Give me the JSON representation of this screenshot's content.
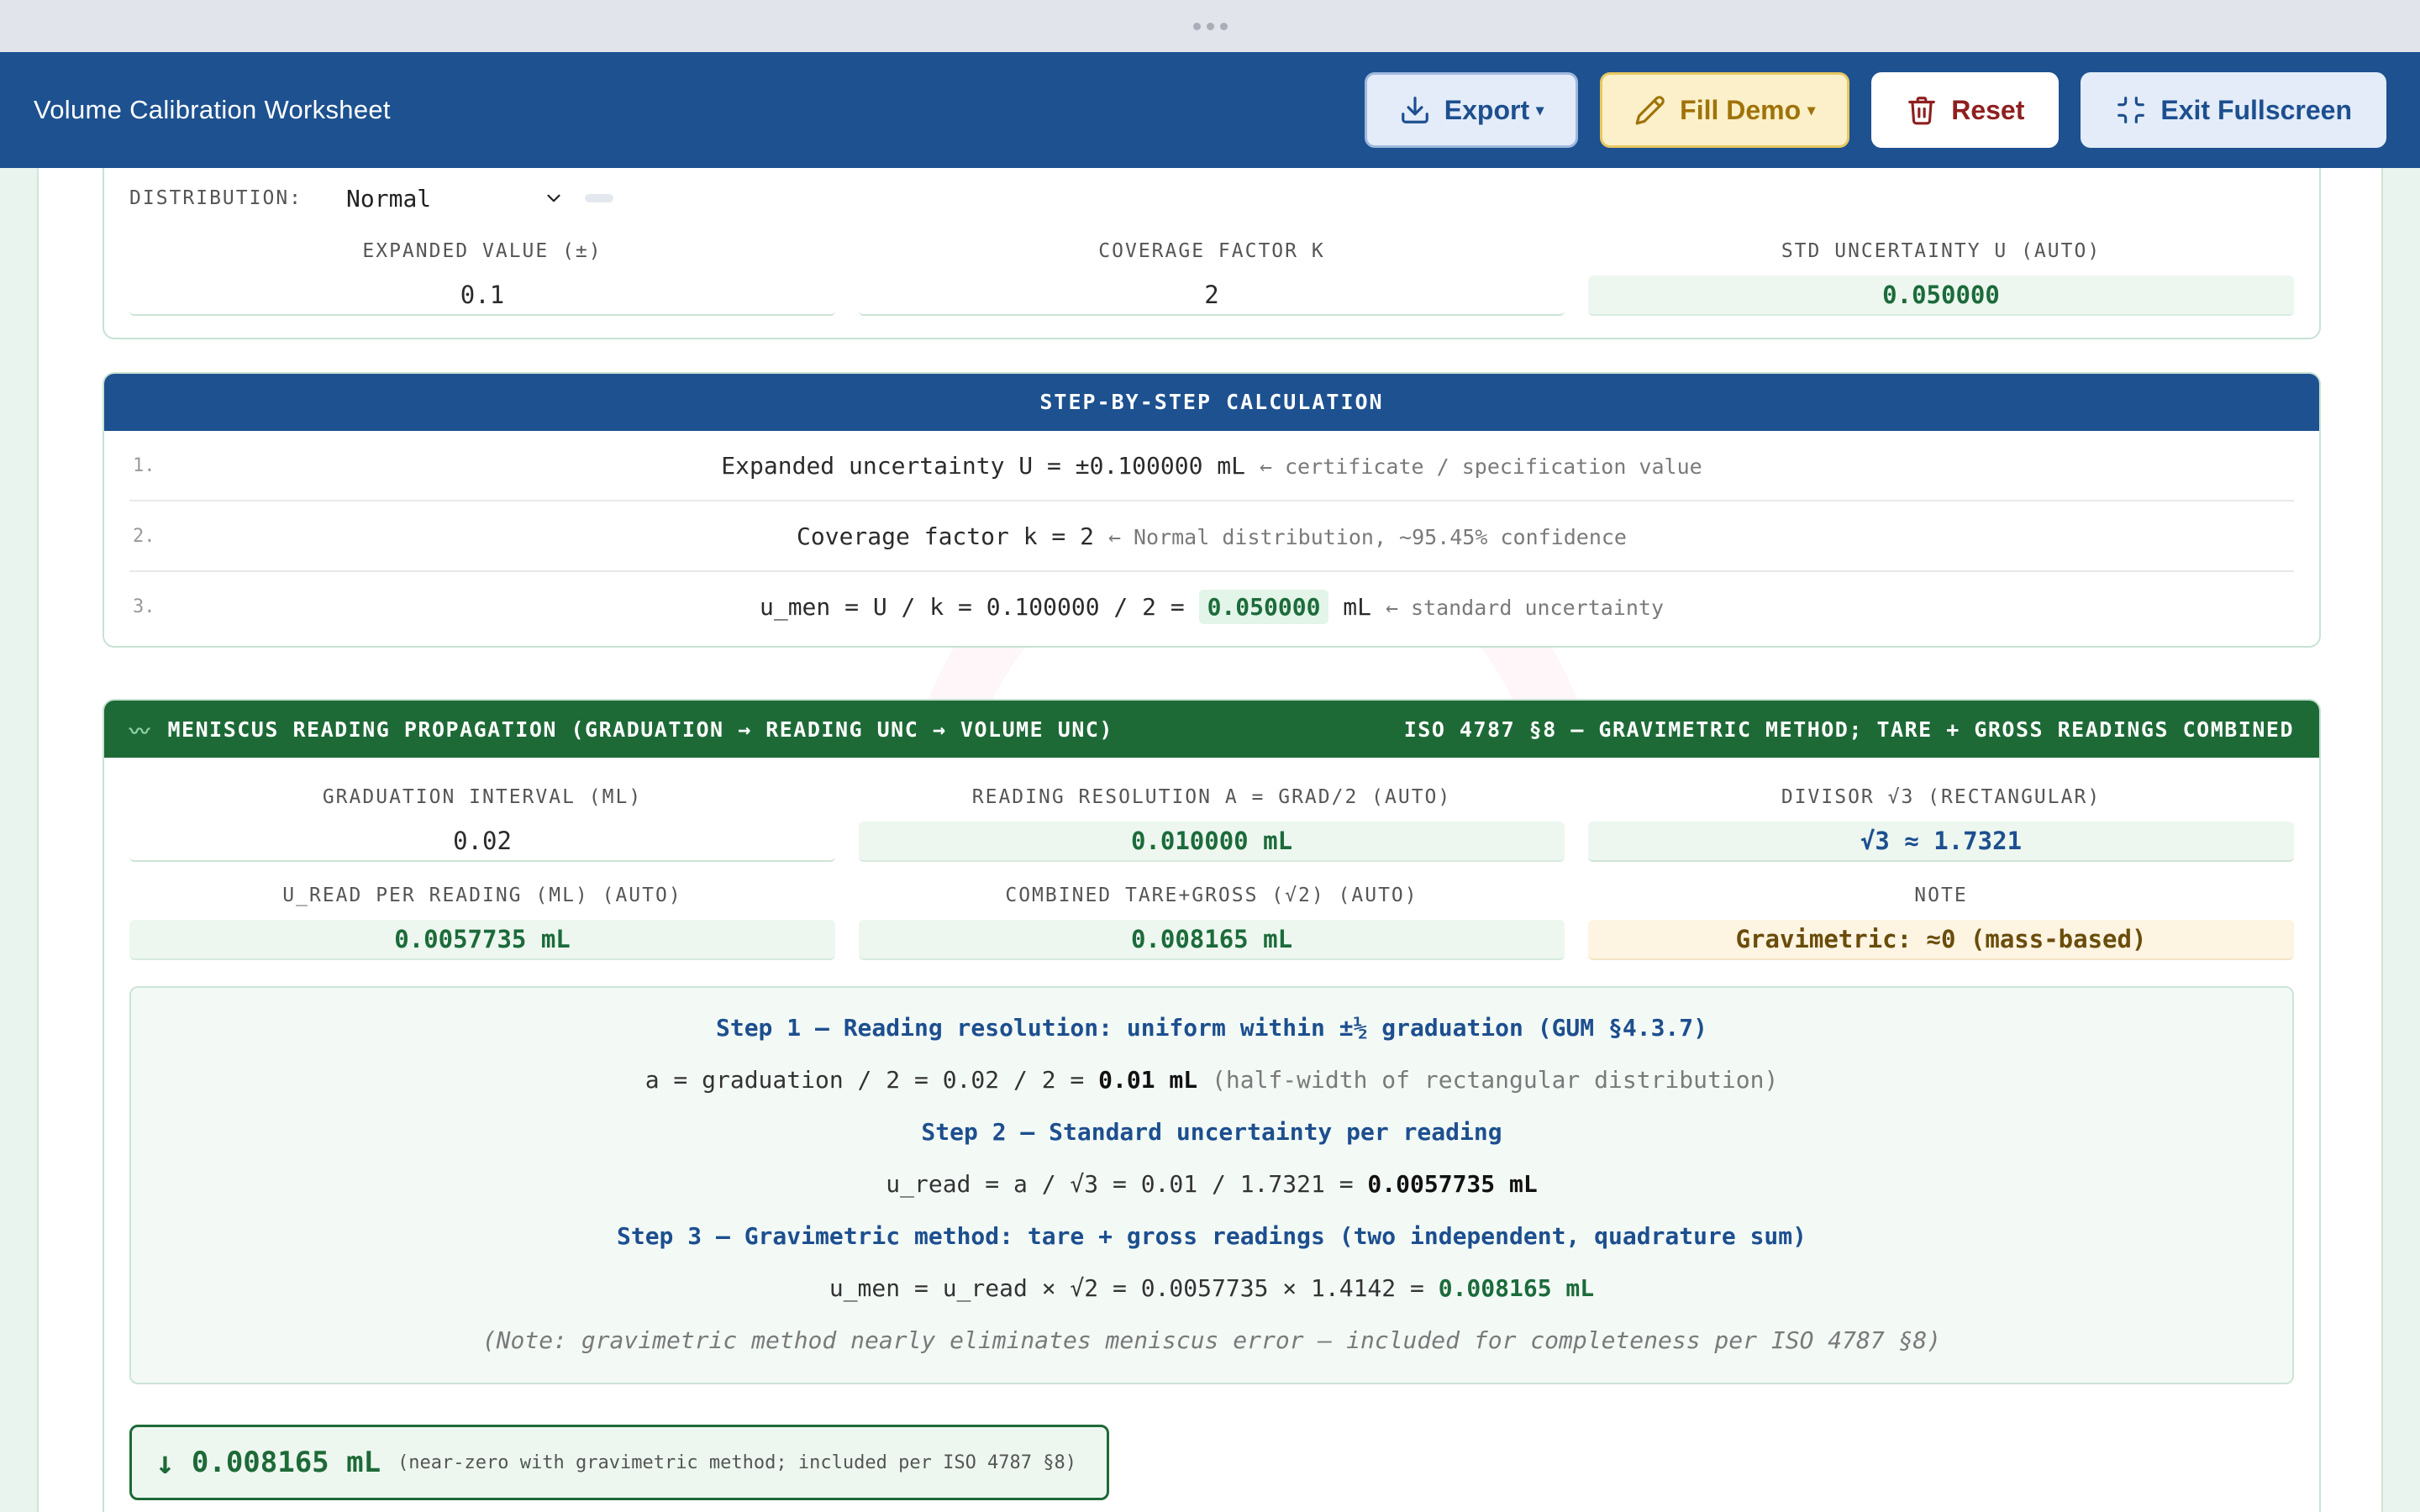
{
  "app": {
    "title": "Volume Calibration Worksheet",
    "buttons": {
      "export": "Export",
      "fill_demo": "Fill Demo",
      "reset": "Reset",
      "exit_fullscreen": "Exit Fullscreen"
    }
  },
  "certificate": {
    "distribution_label": "DISTRIBUTION:",
    "distribution_value": "Normal",
    "expanded_label": "EXPANDED VALUE (±)",
    "expanded_value": "0.1",
    "coverage_label": "COVERAGE FACTOR K",
    "coverage_value": "2",
    "std_label": "STD UNCERTAINTY U (AUTO)",
    "std_value": "0.050000"
  },
  "calculation": {
    "title": "STEP-BY-STEP CALCULATION",
    "rows": [
      {
        "num": "1.",
        "text": "Expanded uncertainty U = ±0.100000 mL ",
        "note": "← certificate / specification value"
      },
      {
        "num": "2.",
        "text": "Coverage factor k = 2 ",
        "note": "← Normal distribution, ~95.45% confidence"
      },
      {
        "num": "3.",
        "pre": "u_men = U / k = 0.100000 / 2 = ",
        "highlight": "0.050000",
        "post": " mL ",
        "note": "← standard uncertainty"
      }
    ]
  },
  "meniscus": {
    "icon": "〰",
    "title": "MENISCUS READING PROPAGATION (GRADUATION → READING UNC → VOLUME UNC)",
    "reference": "ISO 4787 §8 — GRAVIMETRIC METHOD; TARE + GROSS READINGS COMBINED",
    "fields": {
      "graduation_label": "GRADUATION INTERVAL (ML)",
      "graduation_value": "0.02",
      "resolution_label": "READING RESOLUTION A = GRAD/2 (AUTO)",
      "resolution_value": "0.010000 mL",
      "divisor_label": "DIVISOR √3 (RECTANGULAR)",
      "divisor_value": "√3 ≈ 1.7321",
      "uread_label": "U_READ PER READING (ML) (AUTO)",
      "uread_value": "0.0057735 mL",
      "combined_label": "COMBINED TARE+GROSS (√2) (AUTO)",
      "combined_value": "0.008165 mL",
      "note_label": "NOTE",
      "note_value": "Gravimetric: ≈0 (mass-based)"
    },
    "steps": {
      "s1_head": "Step 1 — Reading resolution: uniform within ±½ graduation (GUM §4.3.7)",
      "s1_pre": "a = graduation / 2 = 0.02 / 2 = ",
      "s1_bold": "0.01 mL",
      "s1_note": " (half-width of rectangular distribution)",
      "s2_head": "Step 2 — Standard uncertainty per reading",
      "s2_pre": "u_read = a / √3 = 0.01 / 1.7321 = ",
      "s2_bold": "0.0057735 mL",
      "s3_head": "Step 3 — Gravimetric method: tare + gross readings (two independent, quadrature sum)",
      "s3_pre": "u_men = u_read × √2 = 0.0057735 × 1.4142 = ",
      "s3_bold": "0.008165 mL",
      "note": "(Note: gravimetric method nearly eliminates meniscus error — included for completeness per ISO 4787 §8)"
    },
    "result": {
      "arrow": "↓",
      "value": "0.008165 mL",
      "note": "(near-zero with gravimetric method; included per ISO 4787 §8)"
    }
  }
}
